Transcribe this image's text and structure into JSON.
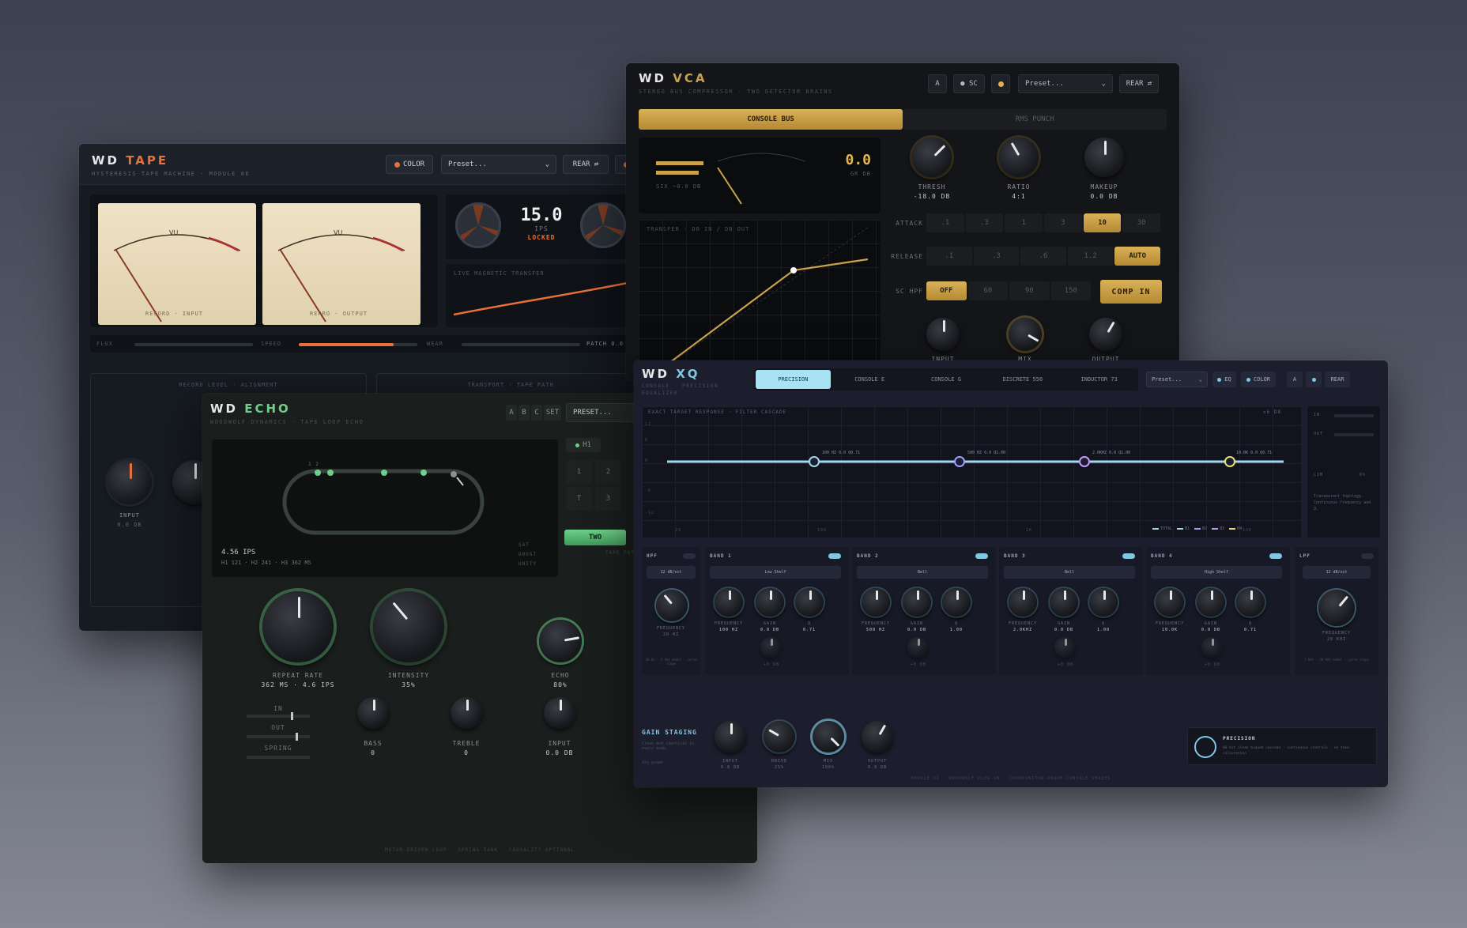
{
  "tape": {
    "brand": "WD",
    "name": "TAPE",
    "subtitle": "HYSTERESIS TAPE MACHINE · MODULE 06",
    "color_btn": "COLOR",
    "preset": "Preset...",
    "rear": "REAR ⇄",
    "meter_left": "RECORD · INPUT",
    "meter_right": "REPRO · OUTPUT",
    "speed": "15.0",
    "speed_unit": "IPS",
    "locked": "LOCKED",
    "transfer_label": "LIVE MAGNETIC TRANSFER",
    "strip_flux": "FLUX",
    "strip_speed": "SPEED",
    "strip_wear": "WEAR",
    "strip_value": "PATCH 0.0 dB",
    "sec_left": "RECORD LEVEL · ALIGNMENT",
    "sec_right": "TRANSPORT · TAPE PATH",
    "knob1_label": "INPUT",
    "knob1_val": "0.0 dB",
    "accent": "#e8703a"
  },
  "vca": {
    "brand": "WD",
    "name": "VCA",
    "subtitle": "STEREO BUS COMPRESSOR · TWO DETECTOR BRAINS",
    "btn_a": "A",
    "btn_sc": "● SC",
    "preset": "Preset...",
    "rear": "REAR ⇄",
    "tab1": "CONSOLE BUS",
    "tab2": "RMS PUNCH",
    "gr_value": "0.0",
    "gr_unit": "GR dB",
    "meter_note": "SIX ~0.0 dB",
    "curve_label": "TRANSFER · dB IN / dB OUT",
    "k_thresh": "THRESH",
    "k_thresh_v": "-18.0 dB",
    "k_ratio": "RATIO",
    "k_ratio_v": "4:1",
    "k_makeup": "MAKEUP",
    "k_makeup_v": "0.0 dB",
    "attack": "ATTACK",
    "attack_opts": [
      ".1",
      ".3",
      "1",
      "3",
      "10",
      "30"
    ],
    "release": "RELEASE",
    "release_opts": [
      ".1",
      ".3",
      ".6",
      "1.2",
      "AUTO"
    ],
    "schpf": "SC HPF",
    "hpf_opts": [
      "OFF",
      "60",
      "90",
      "150"
    ],
    "comp_in": "COMP IN",
    "k_input": "INPUT",
    "k_mix": "MIX",
    "k_output": "OUTPUT",
    "accent": "#c9a24a"
  },
  "echo": {
    "brand": "WD",
    "name": "ECHO",
    "subtitle": "WOODWOLF DYNAMICS · TAPE LOOP ECHO",
    "abc": [
      "A",
      "B",
      "C"
    ],
    "set": "SET",
    "preset": "PRESET...",
    "speed_info": "4.56 IPS",
    "heads_info": "H1 121 · H2 241 · H3 362 MS",
    "tog1": "SAT",
    "tog2": "GHOST",
    "tog3": "UNITY",
    "head_btn": "H1",
    "grid": [
      "1",
      "2",
      "T",
      "3"
    ],
    "two_btn": "TWO",
    "tape_path": "TAPE PATH",
    "k_repeat": "REPEAT RATE",
    "k_repeat_v": "362 ms · 4.6 ips",
    "k_intensity": "INTENSITY",
    "k_intensity_v": "35%",
    "k_echo": "ECHO",
    "k_echo_v": "80%",
    "in": "IN",
    "out": "OUT",
    "spring": "SPRING",
    "k_bass": "BASS",
    "k_bass_v": "0",
    "k_treble": "TREBLE",
    "k_treble_v": "0",
    "k_input": "INPUT",
    "k_input_v": "0.0 dB",
    "footer": "MOTOR-DRIVEN LOOP · SPRING TANK · CAUSALITY OPTIONAL",
    "accent": "#6fd08a"
  },
  "xq": {
    "brand": "WD",
    "name": "XQ",
    "subtitle": "CONSOLE · PRECISION EQUALIZER",
    "modes": [
      "PRECISION",
      "CONSOLE E",
      "CONSOLE G",
      "DISCRETE 550",
      "INDUCTOR 73"
    ],
    "preset": "Preset...",
    "eq_btn": "EQ",
    "color_btn": "COLOR",
    "a_btn": "A",
    "rear": "REAR",
    "graph_title": "EXACT TARGET RESPONSE · FILTER CASCADE",
    "graph_range": "±6 dB",
    "y_ticks": [
      "12",
      "6",
      "0",
      "-6",
      "-12"
    ],
    "x_ticks": [
      "20",
      "100",
      "1k",
      "10k"
    ],
    "node_labels": [
      "100 Hz 0.0 Q0.71",
      "500 Hz 0.0 Q1.00",
      "2.0kHz 0.0 Q1.00",
      "10.0k 0.0 Q0.71"
    ],
    "legend": [
      "TOTAL",
      "B1",
      "B2",
      "B3",
      "B4"
    ],
    "side_in": "IN",
    "side_out": "OUT",
    "side_lim": "LIM",
    "side_lim_v": "0%",
    "side_note": "Transparent topology. Continuous frequency and Q.",
    "hpf": "HPF",
    "hpf_slope": "12 dB/oct",
    "hpf_freq": "FREQUENCY",
    "hpf_freq_v": "20 Hz",
    "hpf_note": "20 Hz · 2 kHz model · curve slope",
    "lpf": "LPF",
    "lpf_slope": "12 dB/oct",
    "lpf_freq": "FREQUENCY",
    "lpf_freq_v": "20 kHz",
    "lpf_note": "1 kHz · 20 kHz model · curve slope",
    "bands": [
      {
        "name": "BAND 1",
        "shape": "Low Shelf",
        "f": "100 Hz",
        "g": "0.0 dB",
        "q": "0.71"
      },
      {
        "name": "BAND 2",
        "shape": "Bell",
        "f": "500 Hz",
        "g": "0.0 dB",
        "q": "1.00"
      },
      {
        "name": "BAND 3",
        "shape": "Bell",
        "f": "2.0kHz",
        "g": "0.0 dB",
        "q": "1.00"
      },
      {
        "name": "BAND 4",
        "shape": "High Shelf",
        "f": "10.0k",
        "g": "0.0 dB",
        "q": "0.71"
      }
    ],
    "freq_lbl": "FREQUENCY",
    "gain_lbl": "GAIN",
    "q_lbl": "Q",
    "dyn_lbl": "DYNAMIC",
    "dyn_v": "+0 dB",
    "gain_staging": "GAIN STAGING",
    "gs_note": "Clean and identical in every mode.",
    "gs_graph": "dry graph",
    "k_input": "INPUT",
    "k_input_v": "0.0 dB",
    "k_drive": "DRIVE",
    "k_drive_v": "25%",
    "k_mix": "MIX",
    "k_mix_v": "100%",
    "k_output": "OUTPUT",
    "k_output_v": "0.0 dB",
    "mode_badge": "PRECISION",
    "mode_desc": "80 bit clean biquad cascade · continuous controls · no tone colouration",
    "footer": "MODULE 02 · WOODWOLF PLUG-IN · COORDINATOR-AWARE CONSOLE SERIES",
    "accent": "#7ec8e3"
  }
}
